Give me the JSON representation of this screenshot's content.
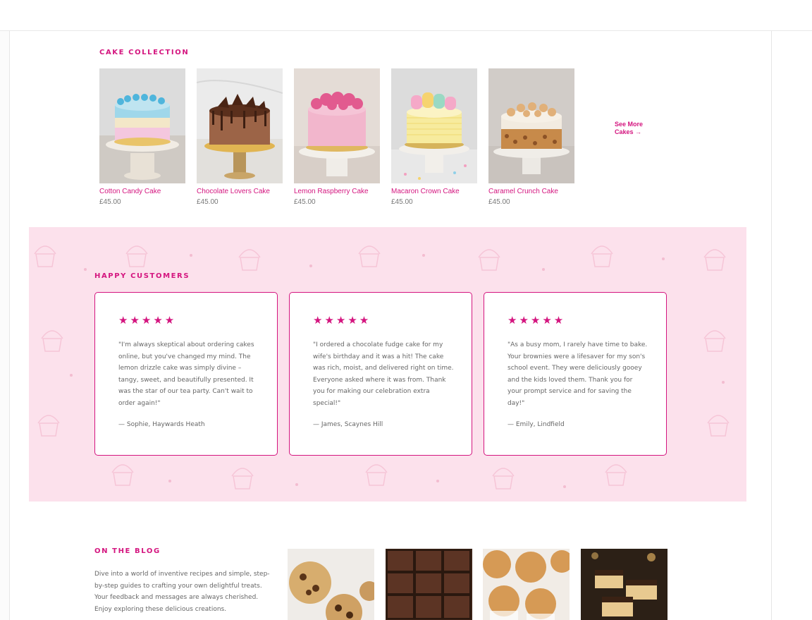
{
  "cakes_section": {
    "heading": "CAKE COLLECTION",
    "see_more": "See More Cakes →",
    "items": [
      {
        "name": "Cotton Candy Cake",
        "price": "£45.00"
      },
      {
        "name": "Chocolate Lovers Cake",
        "price": "£45.00"
      },
      {
        "name": "Lemon Raspberry Cake",
        "price": "£45.00"
      },
      {
        "name": "Macaron Crown Cake",
        "price": "£45.00"
      },
      {
        "name": "Caramel Crunch Cake",
        "price": "£45.00"
      }
    ]
  },
  "testimonials": {
    "heading": "HAPPY CUSTOMERS",
    "items": [
      {
        "stars": "★★★★★",
        "quote": "\"I'm always skeptical about ordering cakes online, but you've changed my mind. The lemon drizzle cake was simply divine – tangy, sweet, and beautifully presented. It was the star of our tea party. Can't wait to order again!\"",
        "author": "— Sophie, Haywards Heath"
      },
      {
        "stars": "★★★★★",
        "quote": "\"I ordered a chocolate fudge cake for my wife's birthday and it was a hit! The cake was rich, moist, and delivered right on time. Everyone asked where it was from. Thank you for making our celebration extra special!\"",
        "author": "— James, Scaynes Hill"
      },
      {
        "stars": "★★★★★",
        "quote": "\"As a busy mom, I rarely have time to bake. Your brownies were a lifesaver for my son's school event. They were deliciously gooey and the kids loved them. Thank you for your prompt service and for saving the day!\"",
        "author": "— Emily, Lindfield"
      }
    ]
  },
  "blog": {
    "heading": "ON THE BLOG",
    "text": "Dive into a world of inventive recipes and simple, step-by-step guides to crafting your own delightful treats. Your feedback and messages are always cherished. Enjoy exploring these delicious creations."
  },
  "colors": {
    "accent": "#d4157f",
    "band": "#fce1ec"
  }
}
